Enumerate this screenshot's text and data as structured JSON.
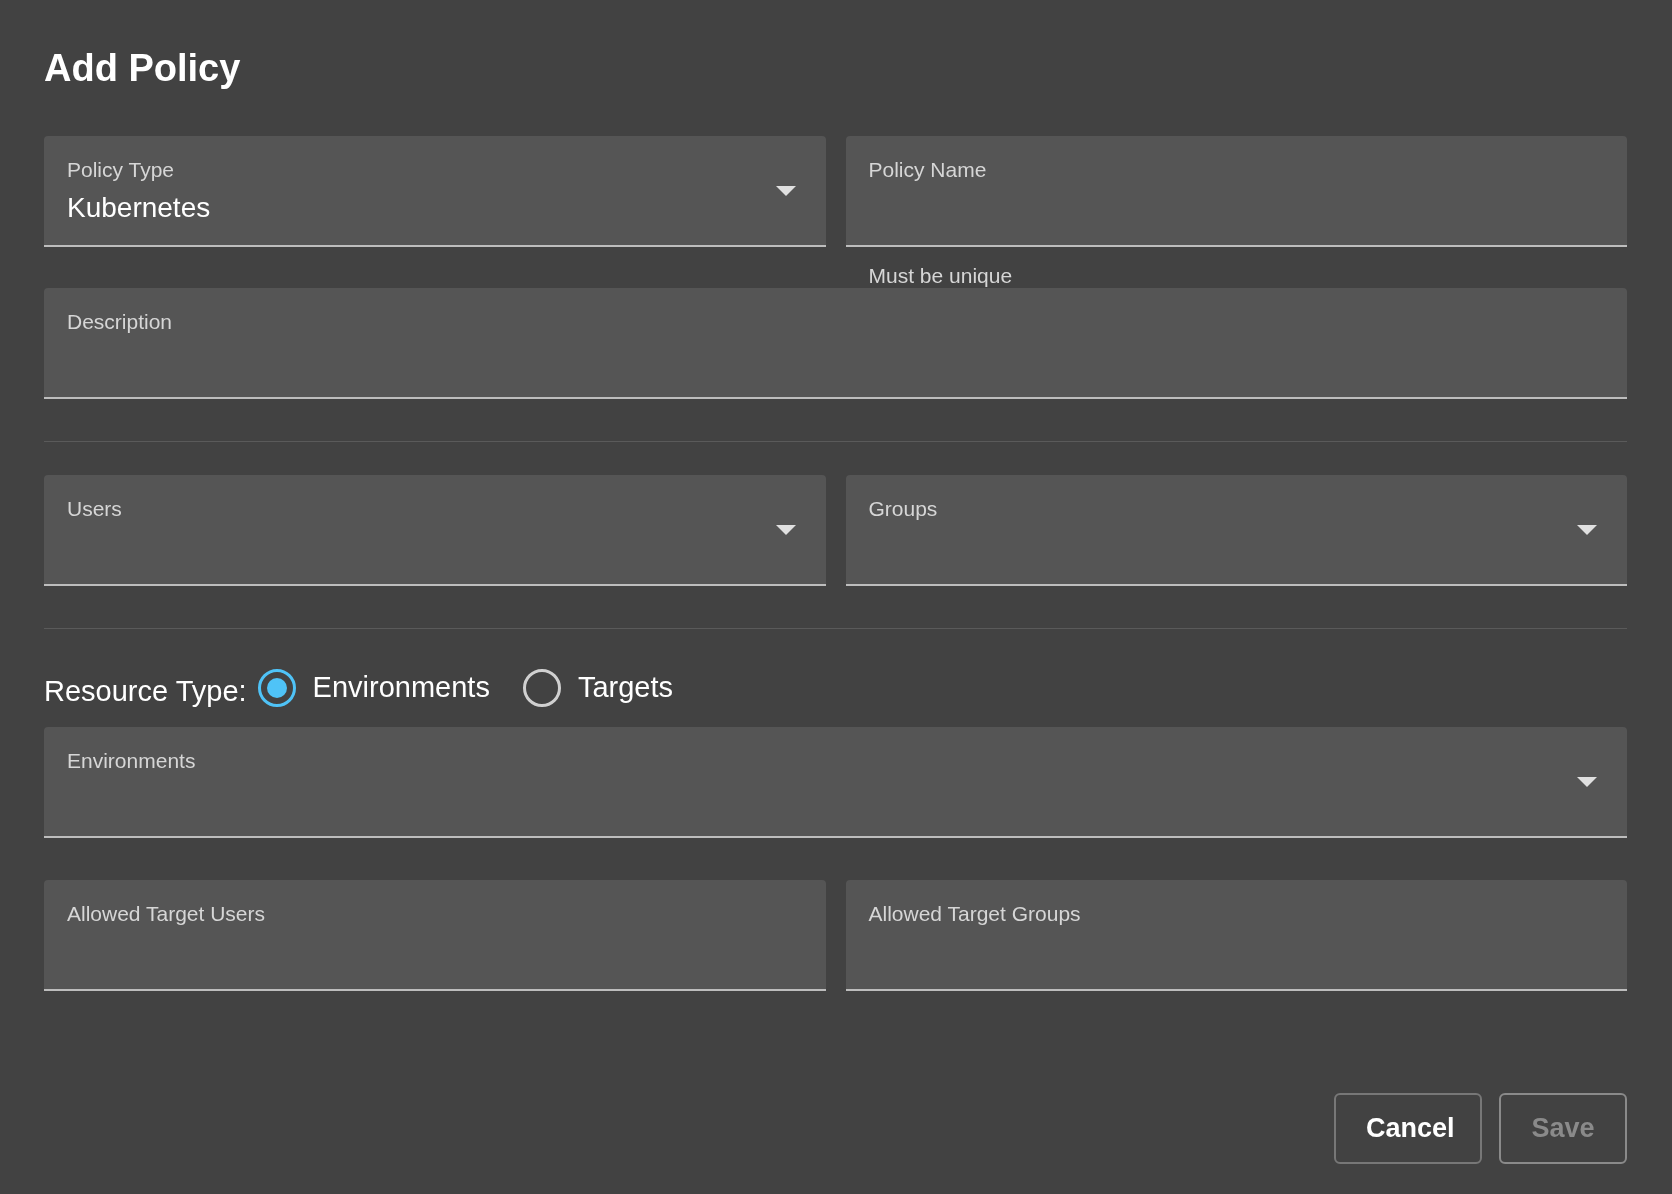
{
  "dialog": {
    "title": "Add Policy"
  },
  "sections": [
    {
      "kind": "fields",
      "fields": [
        {
          "kind": "select",
          "label": "Policy Type",
          "value": "Kubernetes"
        },
        {
          "kind": "text",
          "label": "Policy Name",
          "helper": "Must be unique"
        }
      ]
    },
    {
      "kind": "fields",
      "fields": [
        {
          "kind": "text",
          "label": "Description"
        }
      ]
    },
    {
      "kind": "divider"
    },
    {
      "kind": "fields",
      "fields": [
        {
          "kind": "select",
          "label": "Users"
        },
        {
          "kind": "select",
          "label": "Groups"
        }
      ]
    },
    {
      "kind": "divider"
    },
    {
      "kind": "radio",
      "label": "Resource Type:",
      "options": [
        {
          "label": "Environments",
          "selected": true
        },
        {
          "label": "Targets",
          "selected": false
        }
      ]
    },
    {
      "kind": "fields",
      "fields": [
        {
          "kind": "select",
          "label": "Environments"
        }
      ]
    },
    {
      "kind": "fields",
      "fields": [
        {
          "kind": "text",
          "label": "Allowed Target Users"
        },
        {
          "kind": "text",
          "label": "Allowed Target Groups"
        }
      ]
    }
  ],
  "buttons": [
    {
      "label": "Cancel",
      "disabled": false
    },
    {
      "label": "Save",
      "disabled": true
    }
  ]
}
